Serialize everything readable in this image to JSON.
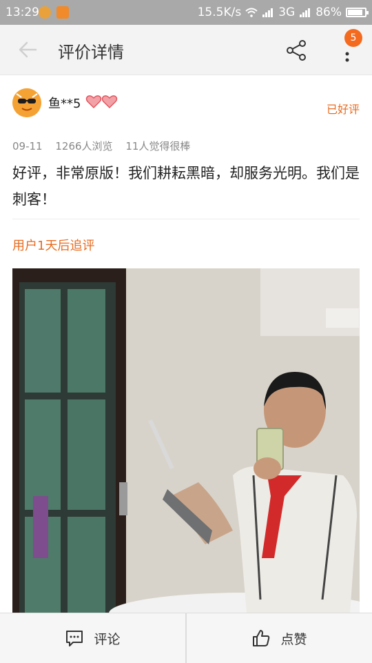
{
  "status_bar": {
    "time": "13:29",
    "net_speed": "15.5K/s",
    "network": "3G",
    "battery": "86%"
  },
  "header": {
    "title": "评价详情",
    "badge_count": "5"
  },
  "review": {
    "username": "鱼**5",
    "rating_label": "已好评",
    "date": "09-11",
    "views": "1266人浏览",
    "likes": "11人觉得很棒",
    "text": "好评，非常原版！我们耕耘黑暗，却服务光明。我们是刺客！",
    "followup_label": "用户1天后追评"
  },
  "bottom_bar": {
    "comment_label": "评论",
    "like_label": "点赞"
  },
  "colors": {
    "accent": "#e86a1e",
    "badge": "#f46a1f",
    "status_bar": "#a9a9a9"
  }
}
